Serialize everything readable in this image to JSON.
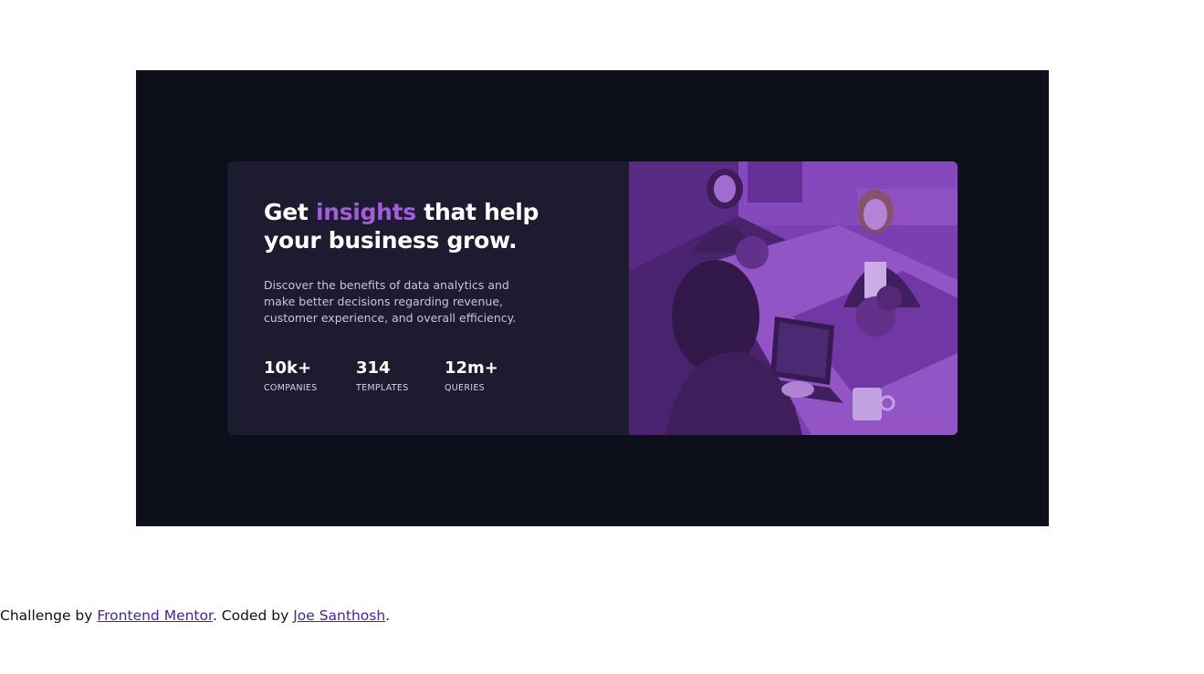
{
  "card": {
    "headline": {
      "part1": "Get ",
      "accent": "insights",
      "part2": " that help",
      "line2": "your business grow."
    },
    "description": "Discover the benefits of data analytics and make better decisions regarding revenue, customer experience, and overall efficiency.",
    "stats": [
      {
        "value": "10k+",
        "label": "COMPANIES"
      },
      {
        "value": "314",
        "label": "TEMPLATES"
      },
      {
        "value": "12m+",
        "label": "QUERIES"
      }
    ]
  },
  "footer": {
    "prefix": "Challenge by ",
    "link1": "Frontend Mentor",
    "middle": ". Coded by ",
    "link2": "Joe Santhosh",
    "suffix": "."
  },
  "colors": {
    "accent": "#a45dd8",
    "card_bg": "#1c1b2f",
    "page_bg": "#0d0f1a",
    "photo_tint": "#7a3fb0"
  }
}
